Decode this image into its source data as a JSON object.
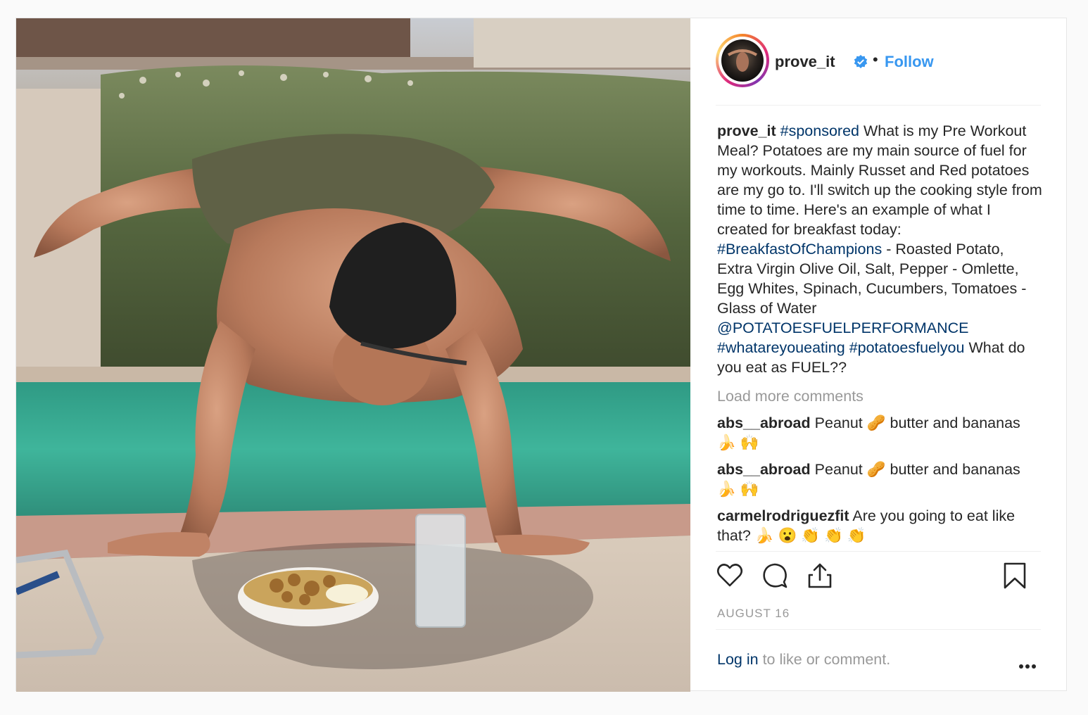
{
  "post": {
    "username": "prove_it",
    "verified": true,
    "follow_label": "Follow",
    "separator": "•",
    "caption": {
      "username": "prove_it",
      "segments": [
        {
          "text": "#sponsored",
          "tag": true
        },
        {
          "text": " What is my Pre Workout Meal? Potatoes are my main source of fuel for my workouts. Mainly Russet and Red potatoes are my go to. I'll switch up the cooking style from time to time. Here's an example of what I created for breakfast today: ",
          "tag": false
        },
        {
          "text": "#BreakfastOfChampions",
          "tag": true
        },
        {
          "text": " - Roasted Potato, Extra Virgin Olive Oil, Salt, Pepper - Omlette, Egg Whites, Spinach, Cucumbers, Tomatoes - Glass of Water ",
          "tag": false
        },
        {
          "text": "@POTATOESFUELPERFORMANCE",
          "tag": true
        },
        {
          "text": " ",
          "tag": false
        },
        {
          "text": "#whatareyoueating",
          "tag": true
        },
        {
          "text": " ",
          "tag": false
        },
        {
          "text": "#potatoesfuelyou",
          "tag": true
        },
        {
          "text": " What do you eat as FUEL??",
          "tag": false
        }
      ]
    },
    "load_more_label": "Load more comments",
    "comments": [
      {
        "username": "abs__abroad",
        "text": "Peanut 🥜  butter and bananas 🍌  🙌"
      },
      {
        "username": "abs__abroad",
        "text": "Peanut 🥜  butter and bananas 🍌  🙌"
      },
      {
        "username": "carmelrodriguezfit",
        "text": "Are you going to eat like that? 🍌 😮 👏 👏 👏"
      }
    ],
    "date": "AUGUST 16",
    "login_link": "Log in",
    "login_rest": " to like or comment.",
    "icons": {
      "like": "heart-icon",
      "comment": "comment-icon",
      "share": "share-icon",
      "save": "bookmark-icon",
      "more": "more-options-icon"
    },
    "colors": {
      "link_blue": "#3897f0",
      "tag_blue": "#003569",
      "muted": "#999999"
    }
  }
}
